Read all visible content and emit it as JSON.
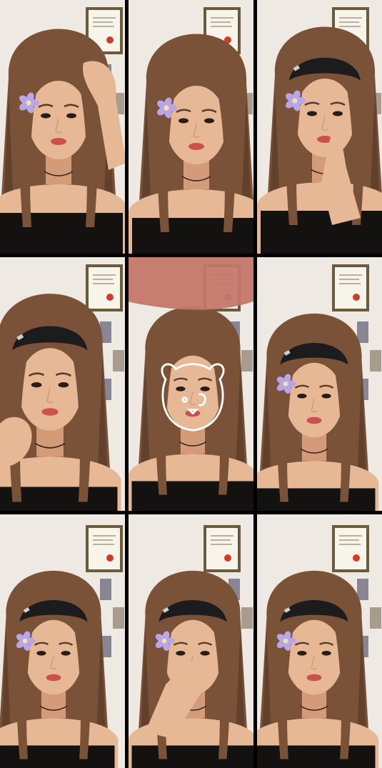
{
  "collage": {
    "rows": 3,
    "columns": 3,
    "background_color": "#000000",
    "tiles": [
      {
        "index": 1,
        "accessory": "purple-flower",
        "hand": "raised-to-head",
        "bear_doodle": false
      },
      {
        "index": 2,
        "accessory": "purple-flower",
        "hand": "none",
        "bear_doodle": false
      },
      {
        "index": 3,
        "accessory": "black-cap-and-flower",
        "hand": "finger-at-lip",
        "bear_doodle": false
      },
      {
        "index": 4,
        "accessory": "black-cap",
        "hand": "on-chin",
        "bear_doodle": false
      },
      {
        "index": 5,
        "accessory": "none",
        "hand": "covering-camera",
        "bear_doodle": true
      },
      {
        "index": 6,
        "accessory": "black-cap-and-flower",
        "hand": "none",
        "bear_doodle": false
      },
      {
        "index": 7,
        "accessory": "black-cap-and-flower",
        "hand": "none",
        "bear_doodle": false
      },
      {
        "index": 8,
        "accessory": "black-cap-and-flower",
        "hand": "on-nose",
        "bear_doodle": false
      },
      {
        "index": 9,
        "accessory": "black-cap-and-flower",
        "hand": "none",
        "bear_doodle": false
      }
    ]
  },
  "colors": {
    "wall": "#efe9e3",
    "hair": "#7a5238",
    "hair_dark": "#4a2f20",
    "skin": "#e7b896",
    "skin_shadow": "#d49b78",
    "lips": "#c9514f",
    "top": "#141111",
    "cap": "#1c1b1d",
    "flower": "#b9a6e8",
    "flower_center": "#f3e3a0",
    "frame": "#6b5a3c",
    "certificate": "#f7f4ea",
    "seal": "#d23a2c",
    "doodle": "#ffffff"
  }
}
